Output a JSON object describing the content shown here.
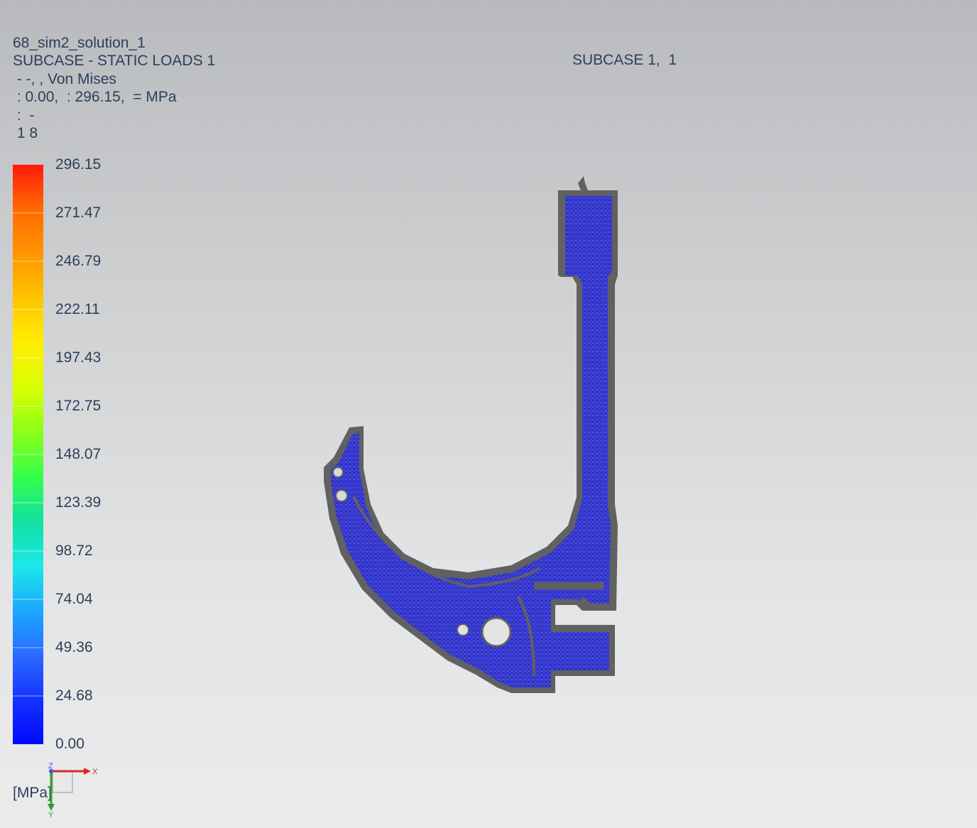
{
  "header": {
    "line1": "68_sim2_solution_1",
    "line2": "SUBCASE - STATIC LOADS 1",
    "line3": " - -, , Von Mises",
    "line4": " : 0.00,  : 296.15,  = MPa",
    "line5": " :  -",
    "line6": " 1 8"
  },
  "subcase_label": "SUBCASE 1,  1",
  "legend": {
    "ticks": [
      "296.15",
      "271.47",
      "246.79",
      "222.11",
      "197.43",
      "172.75",
      "148.07",
      "123.39",
      "98.72",
      "74.04",
      "49.36",
      "24.68",
      "0.00"
    ],
    "unit": "[MPa]",
    "colors": [
      "#ff1a0a",
      "#ff6a00",
      "#ff9500",
      "#ffc400",
      "#ffee00",
      "#d8ff00",
      "#8cff1a",
      "#33ff4a",
      "#12e0a0",
      "#1ce8e8",
      "#1aa8ff",
      "#2a6bff",
      "#1432ff",
      "#0008ff"
    ]
  },
  "triad": {
    "x_label": "X",
    "y_label": "Y",
    "z_label": "Z"
  },
  "model": {
    "fill_color": "#2a2dd6",
    "edge_color": "#616161"
  }
}
